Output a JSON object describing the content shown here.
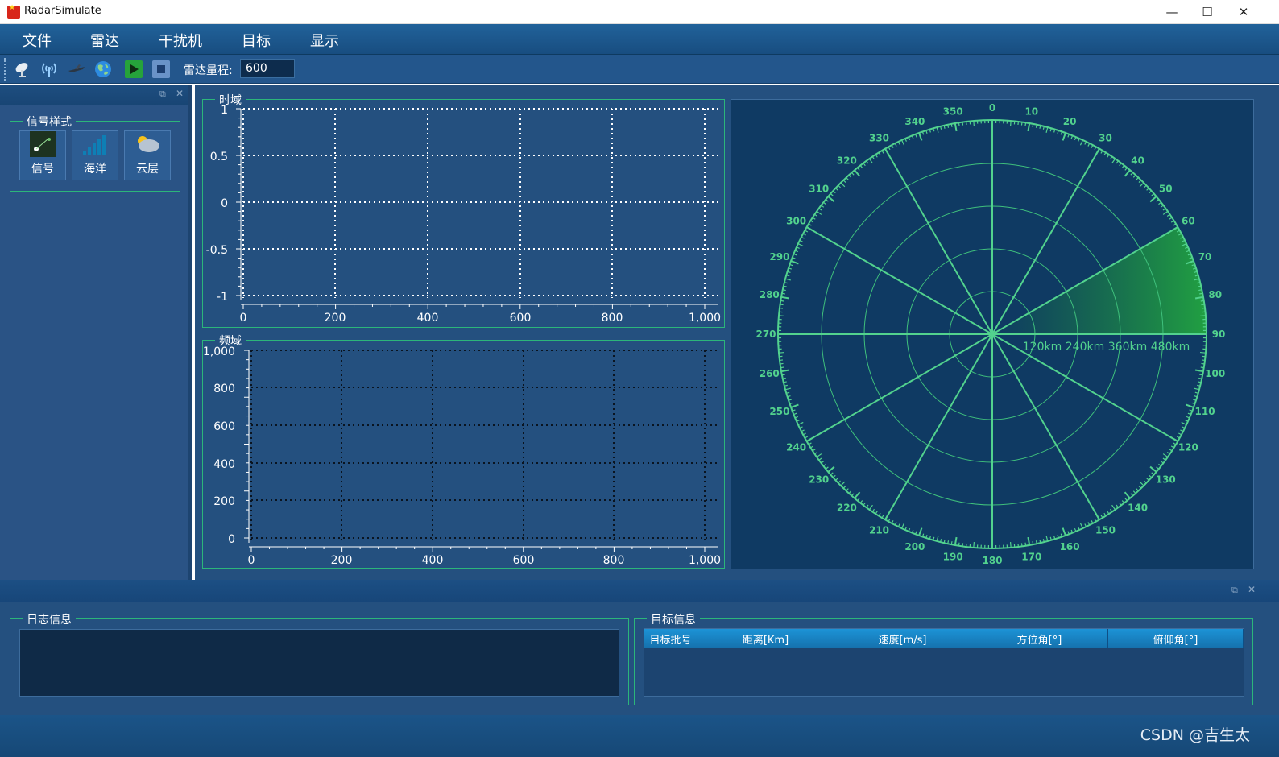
{
  "window": {
    "title": "RadarSimulate",
    "minimize": "—",
    "maximize": "☐",
    "close": "✕"
  },
  "menu": [
    "文件",
    "雷达",
    "干扰机",
    "目标",
    "显示"
  ],
  "toolbar": {
    "icons": [
      "radar-dish-icon",
      "antenna-signal-icon",
      "jammer-aircraft-icon",
      "globe-icon",
      "play-icon",
      "stop-icon"
    ],
    "range_label": "雷达量程:",
    "range_value": "600"
  },
  "signal_panel": {
    "group_label": "信号样式",
    "buttons": [
      {
        "label": "信号",
        "icon": "signal-icon"
      },
      {
        "label": "海洋",
        "icon": "ocean-icon"
      },
      {
        "label": "云层",
        "icon": "cloud-icon"
      }
    ]
  },
  "time_chart": {
    "title": "时域",
    "y_ticks": [
      "1",
      "0.5",
      "0",
      "-0.5",
      "-1"
    ],
    "x_ticks": [
      "0",
      "200",
      "400",
      "600",
      "800",
      "1,000"
    ]
  },
  "freq_chart": {
    "title": "频域",
    "y_ticks": [
      "1,000",
      "800",
      "600",
      "400",
      "200",
      "0"
    ],
    "x_ticks": [
      "0",
      "200",
      "400",
      "600",
      "800",
      "1,000"
    ]
  },
  "radar": {
    "range_labels": [
      "120km",
      "240km",
      "360km",
      "480km"
    ],
    "angle_labels": [
      "0",
      "10",
      "20",
      "30",
      "40",
      "50",
      "60",
      "70",
      "80",
      "90",
      "100",
      "110",
      "120",
      "130",
      "140",
      "150",
      "160",
      "170",
      "180",
      "190",
      "200",
      "210",
      "220",
      "230",
      "240",
      "250",
      "260",
      "270",
      "280",
      "290",
      "300",
      "310",
      "320",
      "330",
      "340",
      "350"
    ],
    "sweep_from_deg": 60,
    "sweep_to_deg": 90
  },
  "log_panel": {
    "group_label": "日志信息"
  },
  "target_panel": {
    "group_label": "目标信息",
    "columns": [
      "目标批号",
      "距离[Km]",
      "速度[m/s]",
      "方位角[°]",
      "俯仰角[°]"
    ]
  },
  "status": {
    "watermark": "CSDN @吉生太"
  },
  "colors": {
    "accent": "#2cb67a",
    "radar_line": "#52d28e",
    "panel": "#24507f",
    "radar_bg": "#0f3a63"
  }
}
